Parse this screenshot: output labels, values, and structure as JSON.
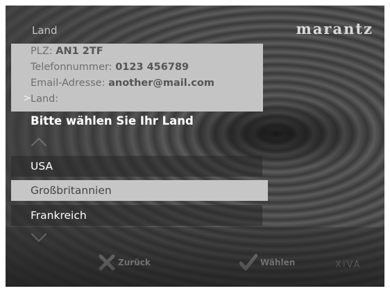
{
  "header": {
    "title": "Land",
    "logo_text": "marantz",
    "brand_color": "#d9d9d9"
  },
  "info": {
    "postcode_label": "PLZ:",
    "postcode_value": "AN1 2TF",
    "phone_label": "Telefonnummer:",
    "phone_value": "0123 456789",
    "email_label": "Email-Adresse:",
    "email_value": "another@mail.com",
    "current_marker": ">",
    "country_label": "Land:"
  },
  "section": {
    "title": "Bitte wählen Sie Ihr Land"
  },
  "countries": {
    "items": [
      "USA",
      "Großbritannien",
      "Frankreich"
    ],
    "selected": "Großbritannien"
  },
  "footer": {
    "back_label": "Zurück",
    "select_label": "Wählen",
    "brand": "XiVA"
  },
  "icons": {
    "back": "x-icon",
    "select": "checkmark-icon",
    "scroll_up": "chevron-up-icon",
    "scroll_down": "chevron-down-icon"
  }
}
